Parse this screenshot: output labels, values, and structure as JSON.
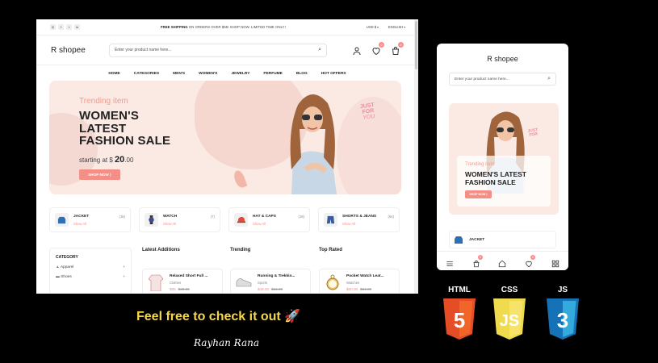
{
  "desktop": {
    "topbar": {
      "socials": [
        "ig",
        "fb",
        "tw",
        "in"
      ],
      "promo_bold": "FREE SHIPPING",
      "promo_rest": "ON ORDERS OVER $55! SHOP NOW. LIMITED TIME ONLY!",
      "currency": "USD $",
      "language": "ENGLISH"
    },
    "header": {
      "logo": "R shopee",
      "search_placeholder": "Enter your product name here...",
      "wishlist_count": "0",
      "cart_count": "0"
    },
    "nav": [
      "HOME",
      "CATEGORIES",
      "MEN'S",
      "WOMEN'S",
      "JEWELRY",
      "PERFUME",
      "BLOG",
      "HOT OFFERS"
    ],
    "hero": {
      "kicker": "Trending item",
      "title_line1": "WOMEN'S",
      "title_line2": "LATEST",
      "title_line3": "FASHION SALE",
      "price_prefix": "starting at $",
      "price_main": "20",
      "price_cents": ".00",
      "cta": "SHOP NOW ⟩",
      "badge_line1": "JUST",
      "badge_line2": "FOR",
      "badge_line3": "YOU"
    },
    "categories": [
      {
        "name": "JACKET",
        "count": "(16)",
        "show": "Show All"
      },
      {
        "name": "WATCH",
        "count": "(7)",
        "show": "Show All"
      },
      {
        "name": "HAT & CAPS",
        "count": "(18)",
        "show": "Show All"
      },
      {
        "name": "SHORTS & JEANS",
        "count": "(64)",
        "show": "Show All"
      }
    ],
    "sidebar": {
      "title": "CATEGORY",
      "items": [
        {
          "label": "Apparel",
          "icon": "dress-icon"
        },
        {
          "label": "Shoes",
          "icon": "shoe-icon"
        }
      ]
    },
    "columns": {
      "latest": "Latest Additions",
      "trending": "Trending",
      "top_rated": "Top Rated"
    },
    "products": [
      {
        "name": "Relaxed Short Full ...",
        "category": "Clothes",
        "price": "$95",
        "old": "$30.00"
      },
      {
        "name": "Running & Trekkin...",
        "category": "Sports",
        "price": "$49.00",
        "old": "$15.00"
      },
      {
        "name": "Pocket Watch Leat...",
        "category": "Watches",
        "price": "$50.00",
        "old": "$34.00"
      }
    ]
  },
  "mobile": {
    "logo": "R shopee",
    "search_placeholder": "Enter your product name here...",
    "hero_kicker": "Trending item",
    "hero_title": "WOMEN'S LATEST FASHION SALE",
    "cta": "SHOP NOW ⟩",
    "category": "JACKET",
    "cart_count": "0",
    "wishlist_count": "0"
  },
  "caption": {
    "tagline": "Feel free to check it out 🚀",
    "author": "Rayhan Rana"
  },
  "tech": [
    {
      "label": "HTML",
      "num": "5",
      "color": "#e44d26"
    },
    {
      "label": "CSS",
      "num": "JS",
      "color": "#f0db4f"
    },
    {
      "label": "JS",
      "num": "3",
      "color": "#1572b6"
    }
  ],
  "colors": {
    "accent": "#f38f86",
    "hero_bg": "#fbe9e4",
    "tagline": "#f5d84a"
  }
}
